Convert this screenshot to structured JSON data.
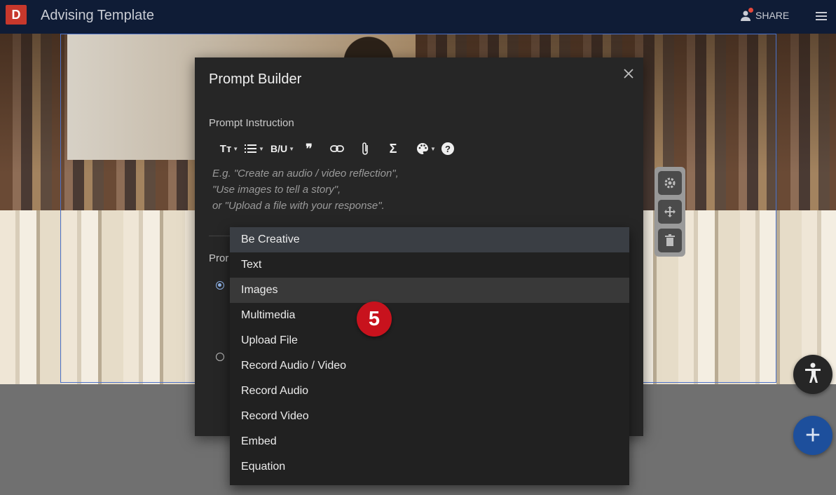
{
  "topbar": {
    "logo_letter": "D",
    "title": "Advising Template",
    "share_label": "SHARE",
    "share_icon": "person-icon",
    "menu_icon": "hamburger-icon"
  },
  "modal": {
    "title": "Prompt Builder",
    "close_icon": "close-icon",
    "section_label": "Prompt Instruction",
    "toolbar": [
      {
        "name": "text-size-icon",
        "glyph": "Tт"
      },
      {
        "name": "list-icon"
      },
      {
        "name": "bold-underline-icon",
        "glyph": "B/U"
      },
      {
        "name": "quote-icon",
        "glyph": "❞"
      },
      {
        "name": "link-icon"
      },
      {
        "name": "attach-icon"
      },
      {
        "name": "sigma-icon",
        "glyph": "Σ"
      },
      {
        "name": "palette-icon"
      },
      {
        "name": "help-icon",
        "glyph": "?"
      }
    ],
    "editor_placeholder": [
      "E.g. \"Create an audio / video reflection\",",
      "\"Use images to tell a story\",",
      "or \"Upload a file with your response\"."
    ],
    "second_label_partial": "Pror"
  },
  "dropdown": {
    "options": [
      "Be Creative",
      "Text",
      "Images",
      "Multimedia",
      "Upload File",
      "Record Audio / Video",
      "Record Audio",
      "Record Video",
      "Embed",
      "Equation"
    ],
    "focused": "Be Creative",
    "hovered": "Images"
  },
  "side_tools": [
    "gear-icon",
    "move-icon",
    "trash-icon"
  ],
  "fab": {
    "accessibility_icon": "accessibility-icon",
    "add_glyph": "+"
  },
  "step_badge": "5",
  "colors": {
    "topbar": "#0f1c36",
    "logo": "#c7382c",
    "modal_bg": "#262626",
    "menu_bg": "#212121",
    "badge": "#c8121d",
    "add_button": "#1d4f9c"
  }
}
